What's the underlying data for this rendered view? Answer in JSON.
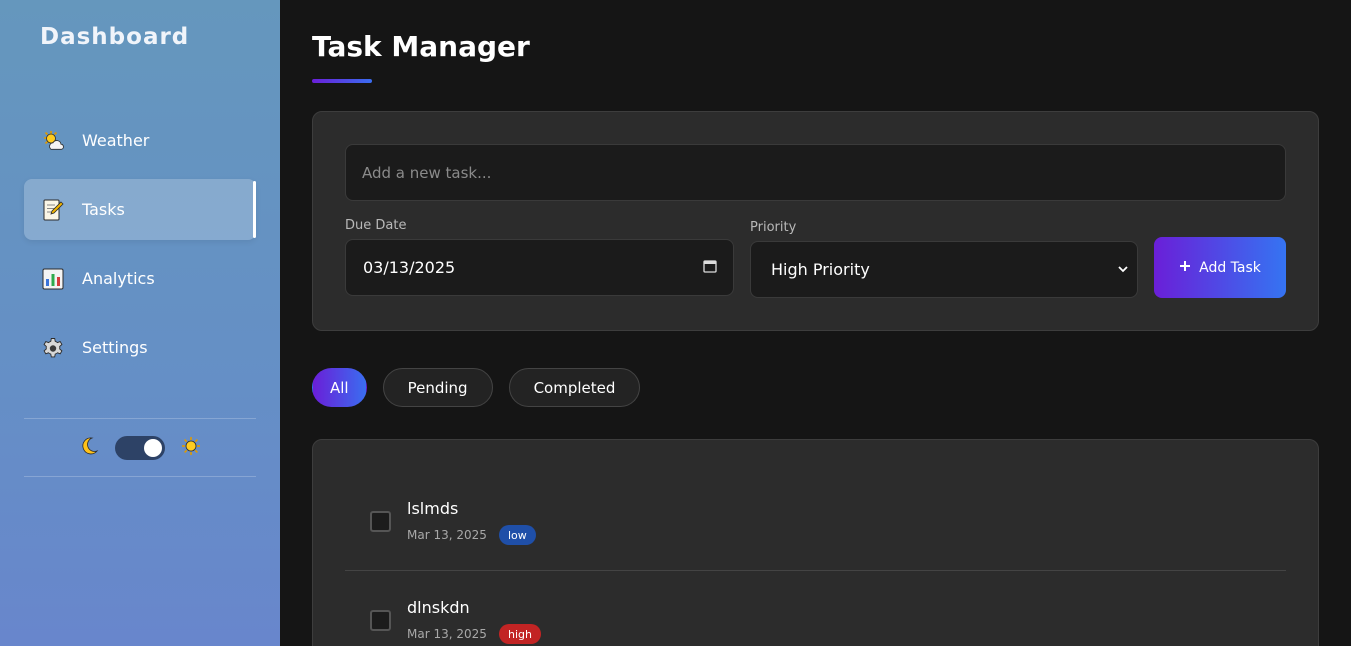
{
  "sidebar": {
    "brand": "Dashboard",
    "items": [
      {
        "label": "Weather",
        "icon": "sun-behind-cloud-icon",
        "active": false
      },
      {
        "label": "Tasks",
        "icon": "memo-icon",
        "active": true
      },
      {
        "label": "Analytics",
        "icon": "bar-chart-icon",
        "active": false
      },
      {
        "label": "Settings",
        "icon": "gear-icon",
        "active": false
      }
    ],
    "theme": {
      "left_icon": "moon-icon",
      "right_icon": "sun-icon",
      "mode": "light"
    }
  },
  "main": {
    "title": "Task Manager",
    "form": {
      "task_placeholder": "Add a new task...",
      "due_date_label": "Due Date",
      "due_date_value": "03/13/2025",
      "priority_label": "Priority",
      "priority_value": "High Priority",
      "add_button_label": "Add Task"
    },
    "filters": [
      {
        "label": "All",
        "active": true
      },
      {
        "label": "Pending",
        "active": false
      },
      {
        "label": "Completed",
        "active": false
      }
    ],
    "tasks": [
      {
        "name": "lslmds",
        "date": "Mar 13, 2025",
        "priority": "low",
        "completed": false
      },
      {
        "name": "dlnskdn",
        "date": "Mar 13, 2025",
        "priority": "high",
        "completed": false
      }
    ]
  },
  "colors": {
    "accent_start": "#6a1fd8",
    "accent_end": "#3574f2",
    "badge_low": "#1f4fa8",
    "badge_high": "#c22424",
    "background": "#151515",
    "card": "#2c2c2c"
  }
}
